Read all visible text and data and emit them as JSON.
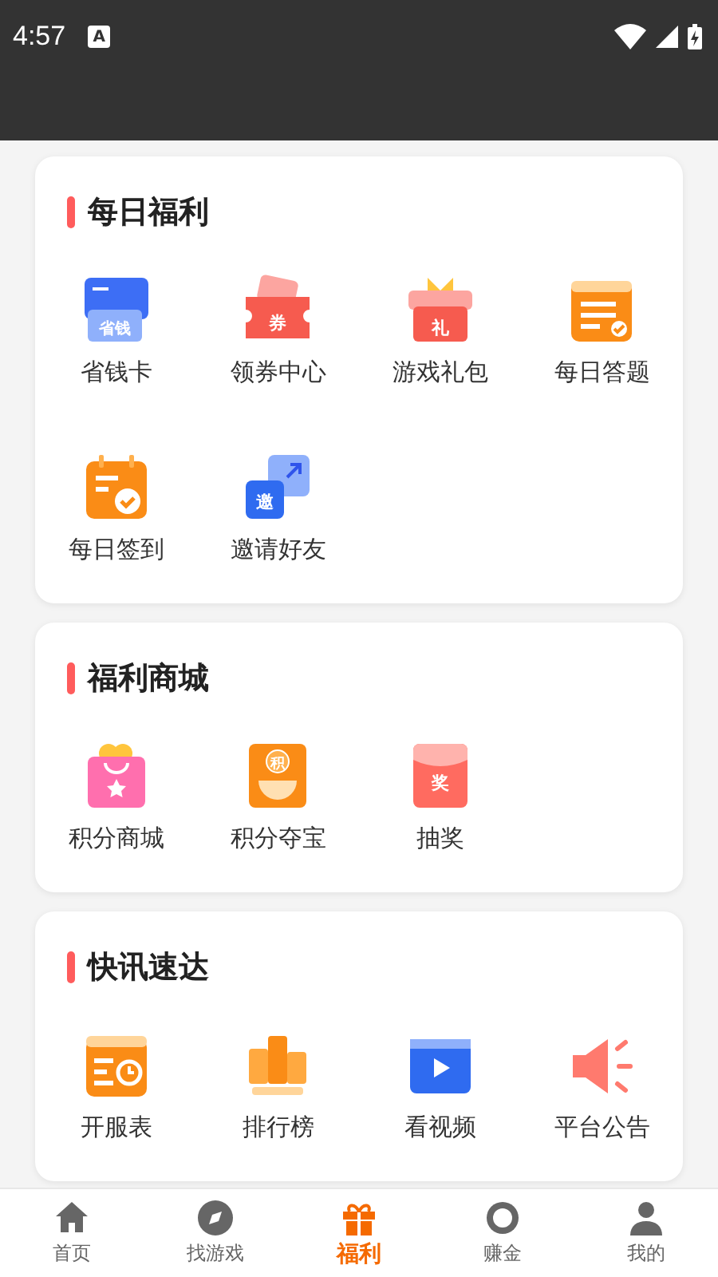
{
  "status_bar": {
    "time": "4:57",
    "notice_icon_text": "A"
  },
  "sections": [
    {
      "title": "每日福利",
      "items": [
        {
          "label": "省钱卡",
          "icon_text": "省钱"
        },
        {
          "label": "领券中心",
          "icon_text": "券"
        },
        {
          "label": "游戏礼包",
          "icon_text": "礼"
        },
        {
          "label": "每日答题"
        },
        {
          "label": "每日签到"
        },
        {
          "label": "邀请好友",
          "icon_text": "邀"
        }
      ]
    },
    {
      "title": "福利商城",
      "items": [
        {
          "label": "积分商城"
        },
        {
          "label": "积分夺宝",
          "icon_text": "积"
        },
        {
          "label": "抽奖",
          "icon_text": "奖"
        }
      ]
    },
    {
      "title": "快讯速达",
      "items": [
        {
          "label": "开服表"
        },
        {
          "label": "排行榜"
        },
        {
          "label": "看视频"
        },
        {
          "label": "平台公告"
        }
      ]
    }
  ],
  "bottom_nav": [
    {
      "label": "首页",
      "selected": false
    },
    {
      "label": "找游戏",
      "selected": false
    },
    {
      "label": "福利",
      "selected": true
    },
    {
      "label": "赚金",
      "selected": false
    },
    {
      "label": "我的",
      "selected": false
    }
  ]
}
